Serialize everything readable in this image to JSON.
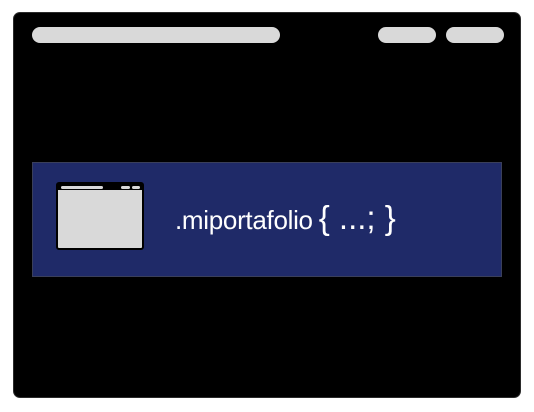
{
  "window": {
    "url_bar": "",
    "controls": [
      "",
      ""
    ]
  },
  "banner": {
    "brand_name": ".miportafolio",
    "brand_code": "{ ...; }",
    "icon": "browser-window-icon"
  },
  "colors": {
    "window_background": "#000000",
    "banner_background": "#1f2a68",
    "chrome_gray": "#d9d9d9",
    "text": "#ffffff"
  }
}
